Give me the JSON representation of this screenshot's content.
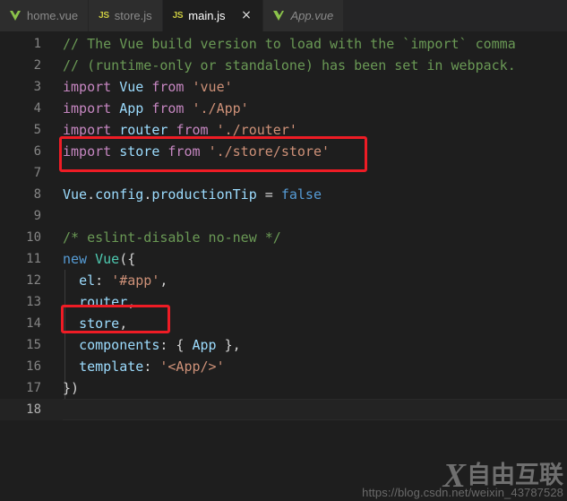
{
  "window": {
    "title": "main.js",
    "theme": "Dark+ (default dark)",
    "editor_background": "#1e1e1e",
    "tabbar_background": "#252526",
    "annotation_color": "#ee1c25"
  },
  "tabbar": {
    "tabs": [
      {
        "label": "home.vue",
        "icon": "vue-file-icon",
        "icon_text": "",
        "active": false,
        "preview": false,
        "closable": false
      },
      {
        "label": "store.js",
        "icon": "js-file-icon",
        "icon_text": "JS",
        "active": false,
        "preview": false,
        "closable": false
      },
      {
        "label": "main.js",
        "icon": "js-file-icon",
        "icon_text": "JS",
        "active": true,
        "preview": false,
        "closable": true
      },
      {
        "label": "App.vue",
        "icon": "vue-file-icon",
        "icon_text": "",
        "active": false,
        "preview": true,
        "closable": false
      }
    ],
    "close_glyph": "×"
  },
  "editor": {
    "current_line": 18,
    "lines": [
      {
        "number": "1",
        "text": "// The Vue build version to load with the `import` comma",
        "tokens": [
          {
            "t": "// The Vue build version to load with the `import` comma",
            "c": "t-comment"
          }
        ]
      },
      {
        "number": "2",
        "text": "// (runtime-only or standalone) has been set in webpack.",
        "tokens": [
          {
            "t": "// (runtime-only or standalone) has been set in webpack.",
            "c": "t-comment"
          }
        ]
      },
      {
        "number": "3",
        "text": "import Vue from 'vue'",
        "tokens": [
          {
            "t": "import",
            "c": "t-keyword"
          },
          {
            "t": " ",
            "c": "t-plain"
          },
          {
            "t": "Vue",
            "c": "t-var"
          },
          {
            "t": " ",
            "c": "t-plain"
          },
          {
            "t": "from",
            "c": "t-keyword"
          },
          {
            "t": " ",
            "c": "t-plain"
          },
          {
            "t": "'vue'",
            "c": "t-string"
          }
        ]
      },
      {
        "number": "4",
        "text": "import App from './App'",
        "tokens": [
          {
            "t": "import",
            "c": "t-keyword"
          },
          {
            "t": " ",
            "c": "t-plain"
          },
          {
            "t": "App",
            "c": "t-var"
          },
          {
            "t": " ",
            "c": "t-plain"
          },
          {
            "t": "from",
            "c": "t-keyword"
          },
          {
            "t": " ",
            "c": "t-plain"
          },
          {
            "t": "'./App'",
            "c": "t-string"
          }
        ]
      },
      {
        "number": "5",
        "text": "import router from './router'",
        "tokens": [
          {
            "t": "import",
            "c": "t-keyword"
          },
          {
            "t": " ",
            "c": "t-plain"
          },
          {
            "t": "router",
            "c": "t-var"
          },
          {
            "t": " ",
            "c": "t-plain"
          },
          {
            "t": "from",
            "c": "t-keyword"
          },
          {
            "t": " ",
            "c": "t-plain"
          },
          {
            "t": "'./router'",
            "c": "t-string"
          }
        ]
      },
      {
        "number": "6",
        "text": "import store from './store/store'",
        "tokens": [
          {
            "t": "import",
            "c": "t-keyword"
          },
          {
            "t": " ",
            "c": "t-plain"
          },
          {
            "t": "store",
            "c": "t-var"
          },
          {
            "t": " ",
            "c": "t-plain"
          },
          {
            "t": "from",
            "c": "t-keyword"
          },
          {
            "t": " ",
            "c": "t-plain"
          },
          {
            "t": "'./store/store'",
            "c": "t-string"
          }
        ]
      },
      {
        "number": "7",
        "text": "",
        "tokens": []
      },
      {
        "number": "8",
        "text": "Vue.config.productionTip = false",
        "tokens": [
          {
            "t": "Vue",
            "c": "t-var"
          },
          {
            "t": ".",
            "c": "t-punct"
          },
          {
            "t": "config",
            "c": "t-var"
          },
          {
            "t": ".",
            "c": "t-punct"
          },
          {
            "t": "productionTip",
            "c": "t-var"
          },
          {
            "t": " ",
            "c": "t-plain"
          },
          {
            "t": "=",
            "c": "t-punct"
          },
          {
            "t": " ",
            "c": "t-plain"
          },
          {
            "t": "false",
            "c": "t-ctrl"
          }
        ]
      },
      {
        "number": "9",
        "text": "",
        "tokens": []
      },
      {
        "number": "10",
        "text": "/* eslint-disable no-new */",
        "tokens": [
          {
            "t": "/* eslint-disable no-new */",
            "c": "t-comment"
          }
        ]
      },
      {
        "number": "11",
        "text": "new Vue({",
        "tokens": [
          {
            "t": "new",
            "c": "t-ctrl"
          },
          {
            "t": " ",
            "c": "t-plain"
          },
          {
            "t": "Vue",
            "c": "t-class"
          },
          {
            "t": "({",
            "c": "t-punct"
          }
        ]
      },
      {
        "number": "12",
        "text": "  el: '#app',",
        "tokens": [
          {
            "t": "  ",
            "c": "t-plain"
          },
          {
            "t": "el",
            "c": "t-var"
          },
          {
            "t": ": ",
            "c": "t-punct"
          },
          {
            "t": "'#app'",
            "c": "t-string"
          },
          {
            "t": ",",
            "c": "t-punct"
          }
        ]
      },
      {
        "number": "13",
        "text": "  router,",
        "tokens": [
          {
            "t": "  ",
            "c": "t-plain"
          },
          {
            "t": "router",
            "c": "t-var"
          },
          {
            "t": ",",
            "c": "t-punct"
          }
        ]
      },
      {
        "number": "14",
        "text": "  store,",
        "tokens": [
          {
            "t": "  ",
            "c": "t-plain"
          },
          {
            "t": "store",
            "c": "t-var"
          },
          {
            "t": ",",
            "c": "t-punct"
          }
        ]
      },
      {
        "number": "15",
        "text": "  components: { App },",
        "tokens": [
          {
            "t": "  ",
            "c": "t-plain"
          },
          {
            "t": "components",
            "c": "t-var"
          },
          {
            "t": ": { ",
            "c": "t-punct"
          },
          {
            "t": "App",
            "c": "t-var"
          },
          {
            "t": " },",
            "c": "t-punct"
          }
        ]
      },
      {
        "number": "16",
        "text": "  template: '<App/>'",
        "tokens": [
          {
            "t": "  ",
            "c": "t-plain"
          },
          {
            "t": "template",
            "c": "t-var"
          },
          {
            "t": ": ",
            "c": "t-punct"
          },
          {
            "t": "'<App/>'",
            "c": "t-string"
          }
        ]
      },
      {
        "number": "17",
        "text": "})",
        "tokens": [
          {
            "t": "})",
            "c": "t-punct"
          }
        ]
      },
      {
        "number": "18",
        "text": "",
        "tokens": []
      }
    ]
  },
  "annotations": [
    {
      "id": "anno-import",
      "target_line": 6,
      "label": "import store from './store/store'"
    },
    {
      "id": "anno-store",
      "target_line": 14,
      "label": "store,"
    }
  ],
  "watermark": {
    "mark": "X",
    "brand": "自由互联",
    "url": "https://blog.csdn.net/weixin_43787528"
  }
}
